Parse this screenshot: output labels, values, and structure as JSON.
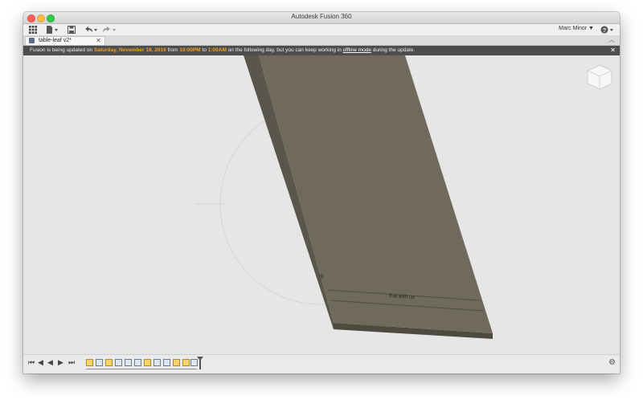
{
  "window": {
    "title": "Autodesk Fusion 360"
  },
  "toolbar": {
    "apps_icon": "grid-icon",
    "file_icon": "file-icon",
    "save_icon": "save-icon",
    "undo_icon": "undo-icon",
    "redo_icon": "redo-icon",
    "user_name": "Marc Minor ▼",
    "help_icon": "help-icon"
  },
  "tab": {
    "label": "table-leaf v2*",
    "close": "✕"
  },
  "banner": {
    "part1": "Fusion is being updated on ",
    "date": "Saturday, November 19, 2016",
    "part2": " from ",
    "start": "10:00PM",
    "part3": " to ",
    "end": "1:00AM",
    "part4": " on the following day, but you can keep working in ",
    "link": "offline mode",
    "part5": " during the update.",
    "close": "✕"
  },
  "model": {
    "engraving": "Eat with us",
    "color": "#6f6a5c"
  },
  "timeline": {
    "controls": [
      "⏮",
      "◀",
      "◀",
      "▶",
      "⏭"
    ],
    "features": [
      "sketch",
      "extrude",
      "sketch",
      "extrude",
      "extrude",
      "extrude",
      "sketch",
      "extrude",
      "extrude",
      "sketch",
      "sketch",
      "extrude",
      "extrude"
    ]
  }
}
